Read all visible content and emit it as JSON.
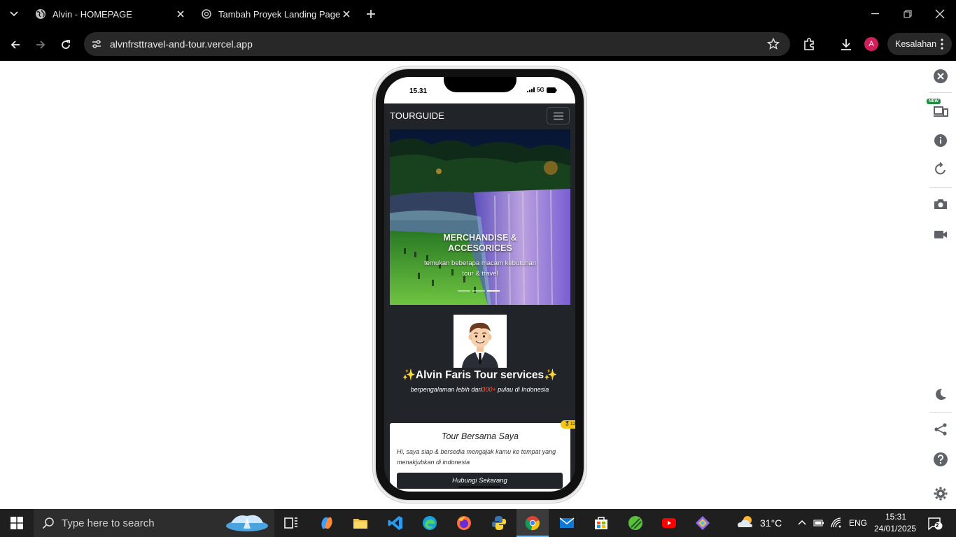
{
  "browser": {
    "tabs": [
      {
        "title": "Alvin - HOMEPAGE",
        "active": true
      },
      {
        "title": "Tambah Proyek Landing Page",
        "active": false
      }
    ],
    "url": "alvnfrsttravel-and-tour.vercel.app",
    "profile_initial": "A",
    "error_button": "Kesalahan"
  },
  "phone": {
    "time": "15.31",
    "network": "5G",
    "site": {
      "brand": "TOURGUIDE",
      "carousel": {
        "title": "MERCHANDISE & ACCESORICES",
        "subtitle": "temukan beberapa macam kebutuhan tour & travel",
        "slides": 3,
        "active_slide": 3
      },
      "profile": {
        "name": "✨Alvin Faris Tour services✨",
        "desc_prefix": "berpengalaman lebih dari",
        "desc_highlight": "300+",
        "desc_suffix": " pulau di Indonesia"
      },
      "card": {
        "title": "Tour Bersama Saya",
        "text": "Hi, saya siap & bersedia mengajak kamu ke tempat yang menakjubkan di indonesia",
        "button": "Hubungi Sekarang",
        "badge": "🎖12"
      }
    }
  },
  "devtools_rail": {
    "new_badge": "NEW",
    "icons": [
      "close-icon",
      "devices-icon",
      "info-icon",
      "rotate-icon",
      "camera-icon",
      "video-icon",
      "moon-icon",
      "share-icon",
      "help-icon",
      "settings-icon"
    ]
  },
  "taskbar": {
    "search_placeholder": "Type here to search",
    "weather_temp": "31°C",
    "language": "ENG",
    "clock_time": "15:31",
    "clock_date": "24/01/2025",
    "notification_count": "2"
  },
  "colors": {
    "site_dark": "#212529",
    "highlight": "#ff5a3c",
    "avatar": "#d11f5a",
    "badge": "#f5c518"
  }
}
